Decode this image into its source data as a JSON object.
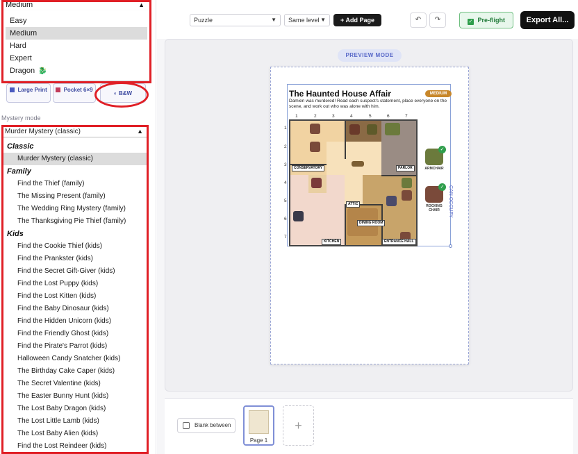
{
  "difficulty": {
    "selected": "Medium",
    "options": [
      "Easy",
      "Medium",
      "Hard",
      "Expert",
      "Dragon"
    ]
  },
  "formats": {
    "large_print": "Large Print",
    "pocket": "Pocket 6×9",
    "bw": "B&W"
  },
  "mystery_mode": {
    "label": "Mystery mode",
    "selected": "Murder Mystery (classic)",
    "groups": [
      {
        "name": "Classic",
        "items": [
          "Murder Mystery (classic)"
        ]
      },
      {
        "name": "Family",
        "items": [
          "Find the Thief (family)",
          "The Missing Present (family)",
          "The Wedding Ring Mystery (family)",
          "The Thanksgiving Pie Thief (family)"
        ]
      },
      {
        "name": "Kids",
        "items": [
          "Find the Cookie Thief (kids)",
          "Find the Prankster (kids)",
          "Find the Secret Gift-Giver (kids)",
          "Find the Lost Puppy (kids)",
          "Find the Lost Kitten (kids)",
          "Find the Baby Dinosaur (kids)",
          "Find the Hidden Unicorn (kids)",
          "Find the Friendly Ghost (kids)",
          "Find the Pirate's Parrot (kids)",
          "Halloween Candy Snatcher (kids)",
          "The Birthday Cake Caper (kids)",
          "The Secret Valentine (kids)",
          "The Easter Bunny Hunt (kids)",
          "The Lost Baby Dragon (kids)",
          "The Lost Little Lamb (kids)",
          "The Lost Baby Alien (kids)",
          "Find the Lost Reindeer (kids)"
        ]
      }
    ]
  },
  "toolbar": {
    "page_type": "Puzzle",
    "level": "Same level",
    "add_page": "+ Add Page",
    "preflight": "Pre-flight",
    "export": "Export All..."
  },
  "canvas": {
    "mode_pill": "PREVIEW MODE",
    "puzzle": {
      "title": "The Haunted House Affair",
      "badge": "MEDIUM",
      "description": "Damien was murdered! Read each suspect's statement, place everyone on the scene, and work out who was alone with him.",
      "columns": [
        "1",
        "2",
        "3",
        "4",
        "5",
        "6",
        "7"
      ],
      "rows": [
        "1",
        "2",
        "3",
        "4",
        "5",
        "6",
        "7"
      ],
      "rooms": [
        "CONSERVATORY",
        "PARLOR",
        "ATTIC",
        "DINING ROOM",
        "KITCHEN",
        "ENTRANCE HALL"
      ],
      "side_items": [
        "ARMCHAIR",
        "ROCKING CHAIR"
      ],
      "side_note": "CAN OCCUPY"
    }
  },
  "footer": {
    "blank_between": "Blank between",
    "page_label": "Page 1",
    "add_tile": "+"
  },
  "colors": {
    "highlight_red": "#e01f26",
    "accent_blue": "#5868c8",
    "preflight_green": "#2f9e4c",
    "badge_orange": "#c8872a"
  }
}
